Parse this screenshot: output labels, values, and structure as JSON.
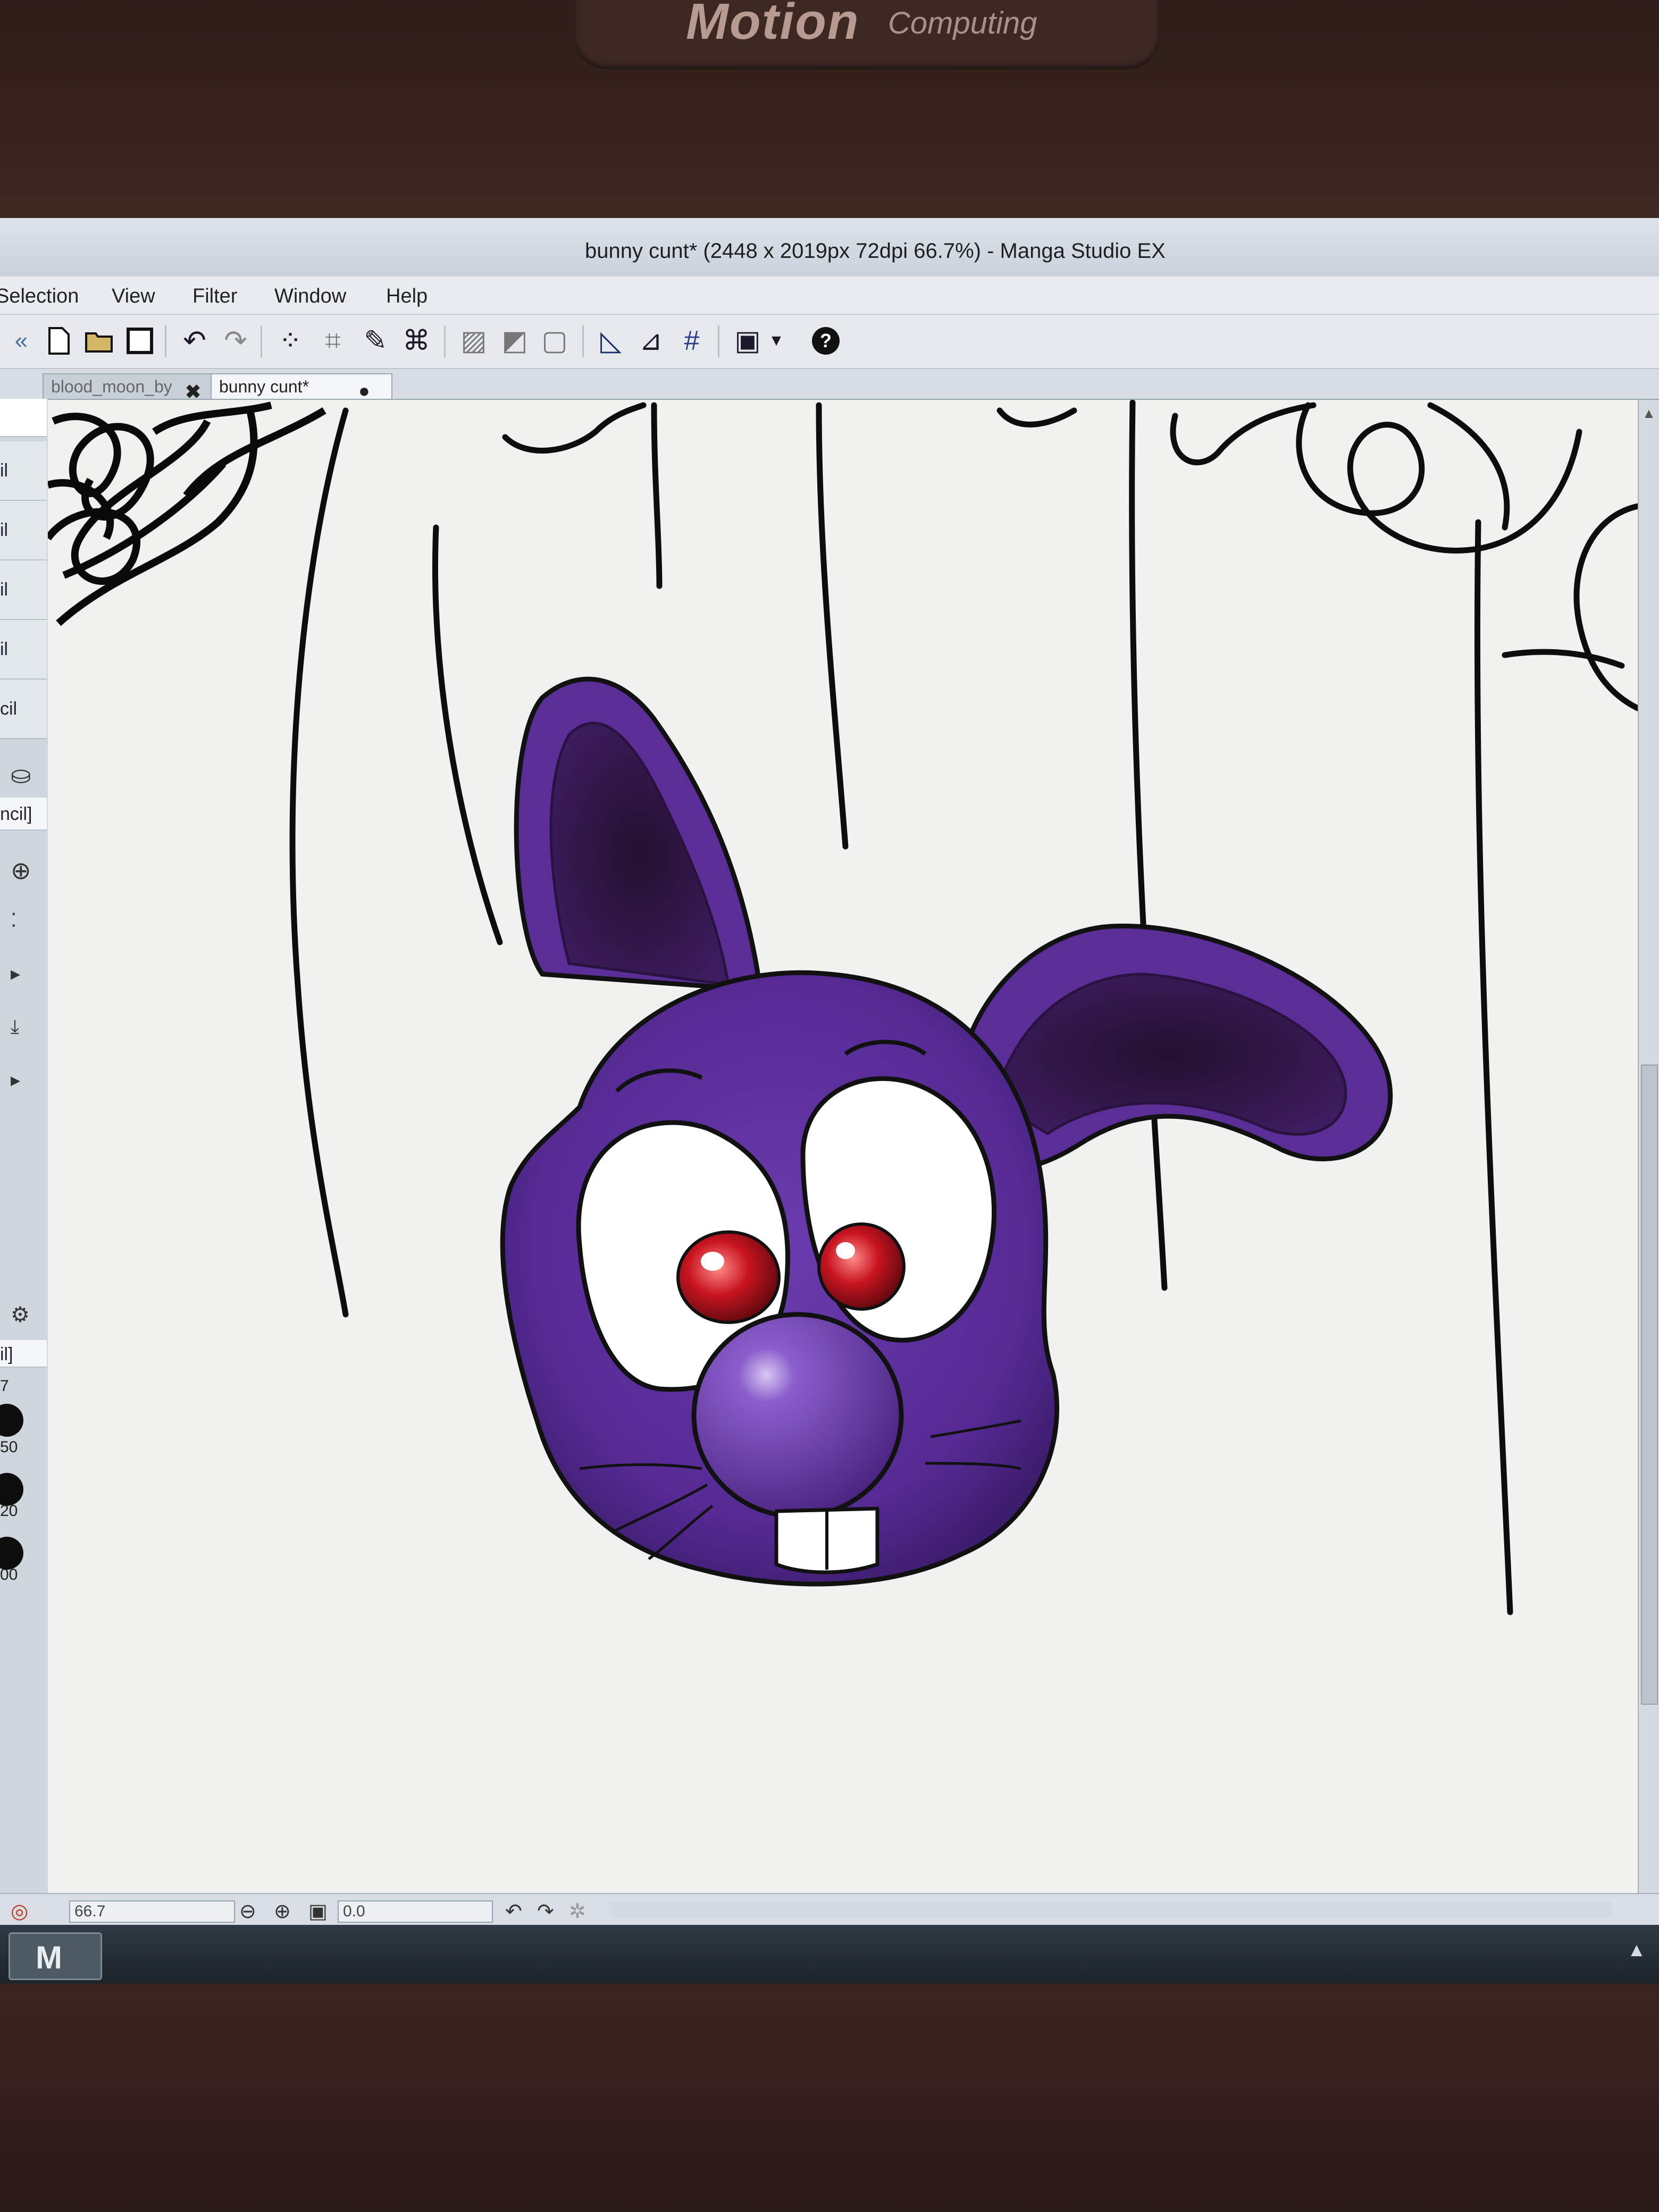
{
  "device": {
    "brand": "Motion",
    "brand_sub": "Computing"
  },
  "window": {
    "title": "bunny cunt* (2448 x 2019px 72dpi 66.7%)  - Manga Studio EX"
  },
  "menubar": {
    "items": [
      "Selection",
      "View",
      "Filter",
      "Window",
      "Help"
    ]
  },
  "toolbar": {
    "icons": [
      "collapse-icon",
      "new-file-icon",
      "open-file-icon",
      "save-icon",
      "undo-icon",
      "redo-icon",
      "selection-icon",
      "crop-icon",
      "pen-settings-icon",
      "transform-icon",
      "grid-icon",
      "tone-icon",
      "frame-icon",
      "ruler-icon",
      "perspective-icon",
      "snap-icon",
      "screen-icon",
      "dropdown-icon",
      "help-icon"
    ]
  },
  "tabs": [
    {
      "label": "blood_moon_by",
      "active": false
    },
    {
      "label": "bunny cunt*",
      "active": true
    }
  ],
  "left_panel": {
    "rows": [
      "il",
      "il",
      "il",
      "il",
      "cil"
    ],
    "tool_label": "ncil]",
    "brush_label": "il]",
    "sizes": [
      "7",
      "50",
      "20",
      "00"
    ]
  },
  "statusbar": {
    "zoom": "66.7",
    "rotation": "0.0"
  },
  "taskbar": {
    "app_glyph": "M"
  },
  "colors": {
    "bunny_fill": "#5c2e9a",
    "bunny_dark": "#2a123e",
    "eye_red": "#c4141e",
    "canvas": "#f1f1ef"
  }
}
